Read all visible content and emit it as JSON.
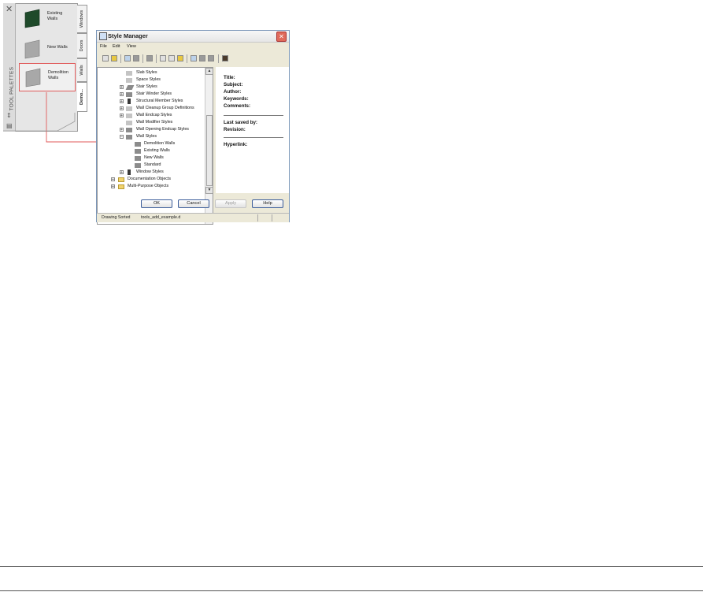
{
  "palette": {
    "title": "TOOL PALETTES",
    "tools": [
      {
        "label": "Existing Walls",
        "color": "#1e4a2a"
      },
      {
        "label": "New Walls",
        "color": "#a8a8a8"
      },
      {
        "label": "Demolition Walls",
        "color": "#a8a8a8"
      }
    ],
    "tabs": [
      "Windows",
      "Doors",
      "Walls",
      "Demo..."
    ]
  },
  "window": {
    "title": "Style Manager",
    "menu": [
      "File",
      "Edit",
      "View"
    ],
    "tree": [
      {
        "label": "Slab Styles",
        "icon": "slab-icon"
      },
      {
        "label": "Space Styles",
        "icon": "space-icon"
      },
      {
        "label": "Stair Styles",
        "icon": "stair-icon"
      },
      {
        "label": "Stair Winder Styles",
        "icon": "stair-winder-icon"
      },
      {
        "label": "Structural Member Styles",
        "icon": "structural-member-icon"
      },
      {
        "label": "Wall Cleanup Group Definitions",
        "icon": "wall-cleanup-icon"
      },
      {
        "label": "Wall Endcap Styles",
        "icon": "wall-endcap-icon"
      },
      {
        "label": "Wall Modifier Styles",
        "icon": "wall-modifier-icon"
      },
      {
        "label": "Wall Opening Endcap Styles",
        "icon": "wall-opening-endcap-icon"
      },
      {
        "label": "Wall Styles",
        "icon": "wall-styles-icon"
      },
      {
        "label": "Demolition Walls",
        "icon": "wall-style-icon"
      },
      {
        "label": "Existing Walls",
        "icon": "wall-style-icon"
      },
      {
        "label": "New Walls",
        "icon": "wall-style-icon"
      },
      {
        "label": "Standard",
        "icon": "wall-style-icon"
      },
      {
        "label": "Window Styles",
        "icon": "window-styles-icon"
      },
      {
        "label": "Documentation Objects",
        "icon": "folder-icon"
      },
      {
        "label": "Multi-Purpose Objects",
        "icon": "folder-icon"
      }
    ],
    "properties": {
      "title": "Title:",
      "subject": "Subject:",
      "author": "Author:",
      "keywords": "Keywords:",
      "comments": "Comments:",
      "last_saved_by": "Last saved by:",
      "revision": "Revision:",
      "hyperlink": "Hyperlink:"
    },
    "buttons": {
      "ok": "OK",
      "cancel": "Cancel",
      "apply": "Apply",
      "help": "Help"
    },
    "status": {
      "mode": "Drawing Sorted",
      "file": "tools_add_example.d"
    }
  }
}
